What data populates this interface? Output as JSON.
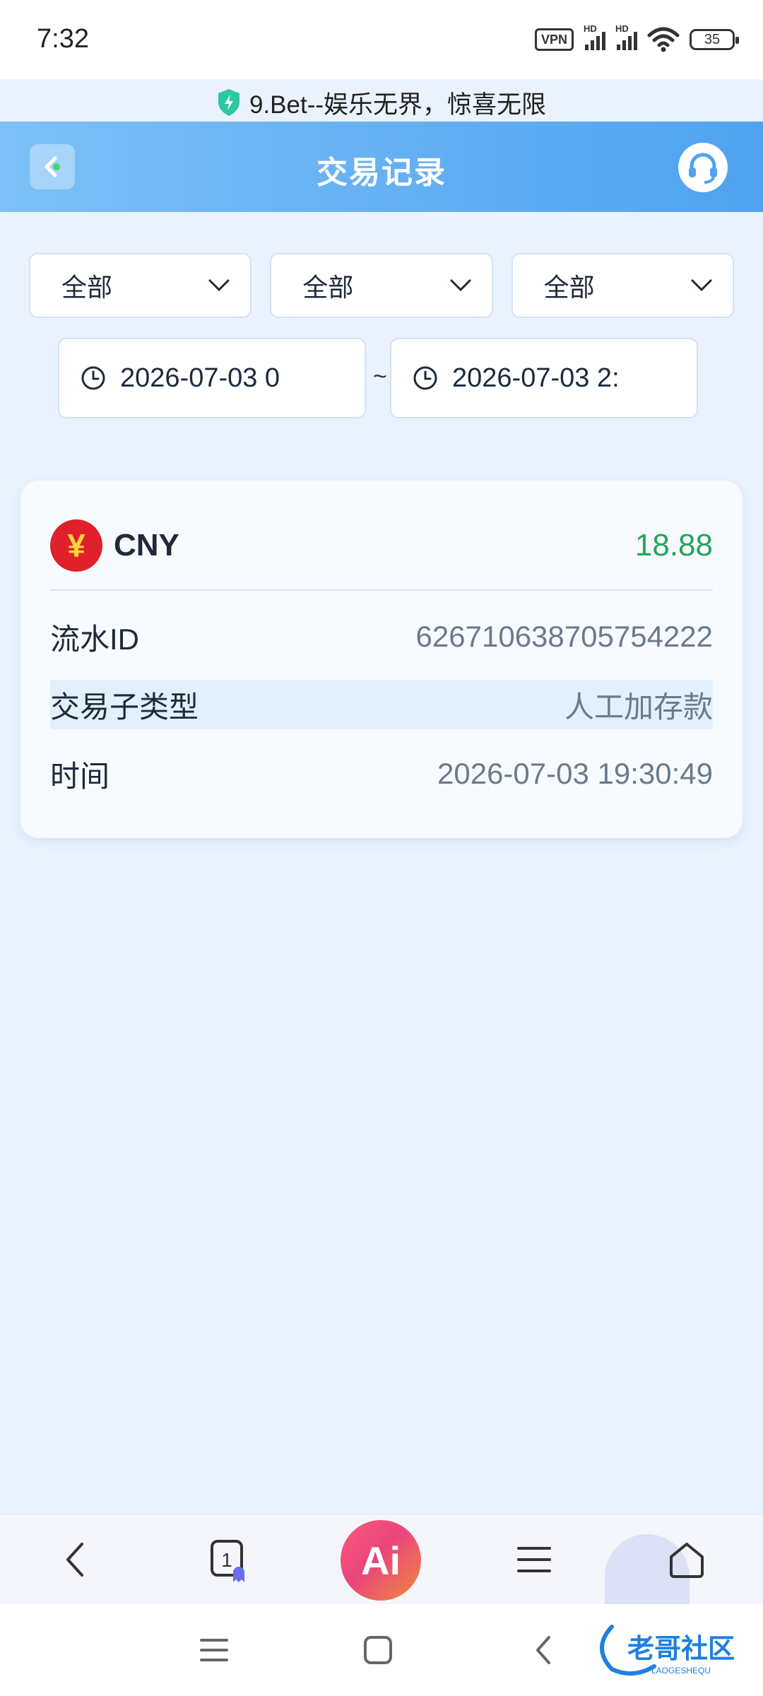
{
  "status_bar": {
    "time": "7:32",
    "vpn": "VPN",
    "hd1": "HD",
    "hd2": "HD",
    "battery": "35"
  },
  "site": {
    "title": "9.Bet--娱乐无界，惊喜无限"
  },
  "header": {
    "title": "交易记录"
  },
  "filters": {
    "selects": [
      "全部",
      "全部",
      "全部"
    ],
    "date_start": "2026-07-03 0",
    "date_separator": "~",
    "date_end": "2026-07-03 2:"
  },
  "record": {
    "currency_symbol": "¥",
    "currency_code": "CNY",
    "amount": "18.88",
    "rows": [
      {
        "label": "流水ID",
        "value": "626710638705754222"
      },
      {
        "label": "交易子类型",
        "value": "人工加存款"
      },
      {
        "label": "时间",
        "value": "2026-07-03 19:30:49"
      }
    ]
  },
  "browser_toolbar": {
    "tab_count": "1",
    "ai_label": "Ai"
  },
  "watermark": {
    "text": "老哥社区",
    "subtext": "LAOGESHEQU"
  },
  "colors": {
    "header_gradient_start": "#7cc0f7",
    "header_gradient_end": "#4fa2f1",
    "amount_green": "#22a55c",
    "currency_red": "#e0202a",
    "page_bg": "#eaf3fd"
  }
}
